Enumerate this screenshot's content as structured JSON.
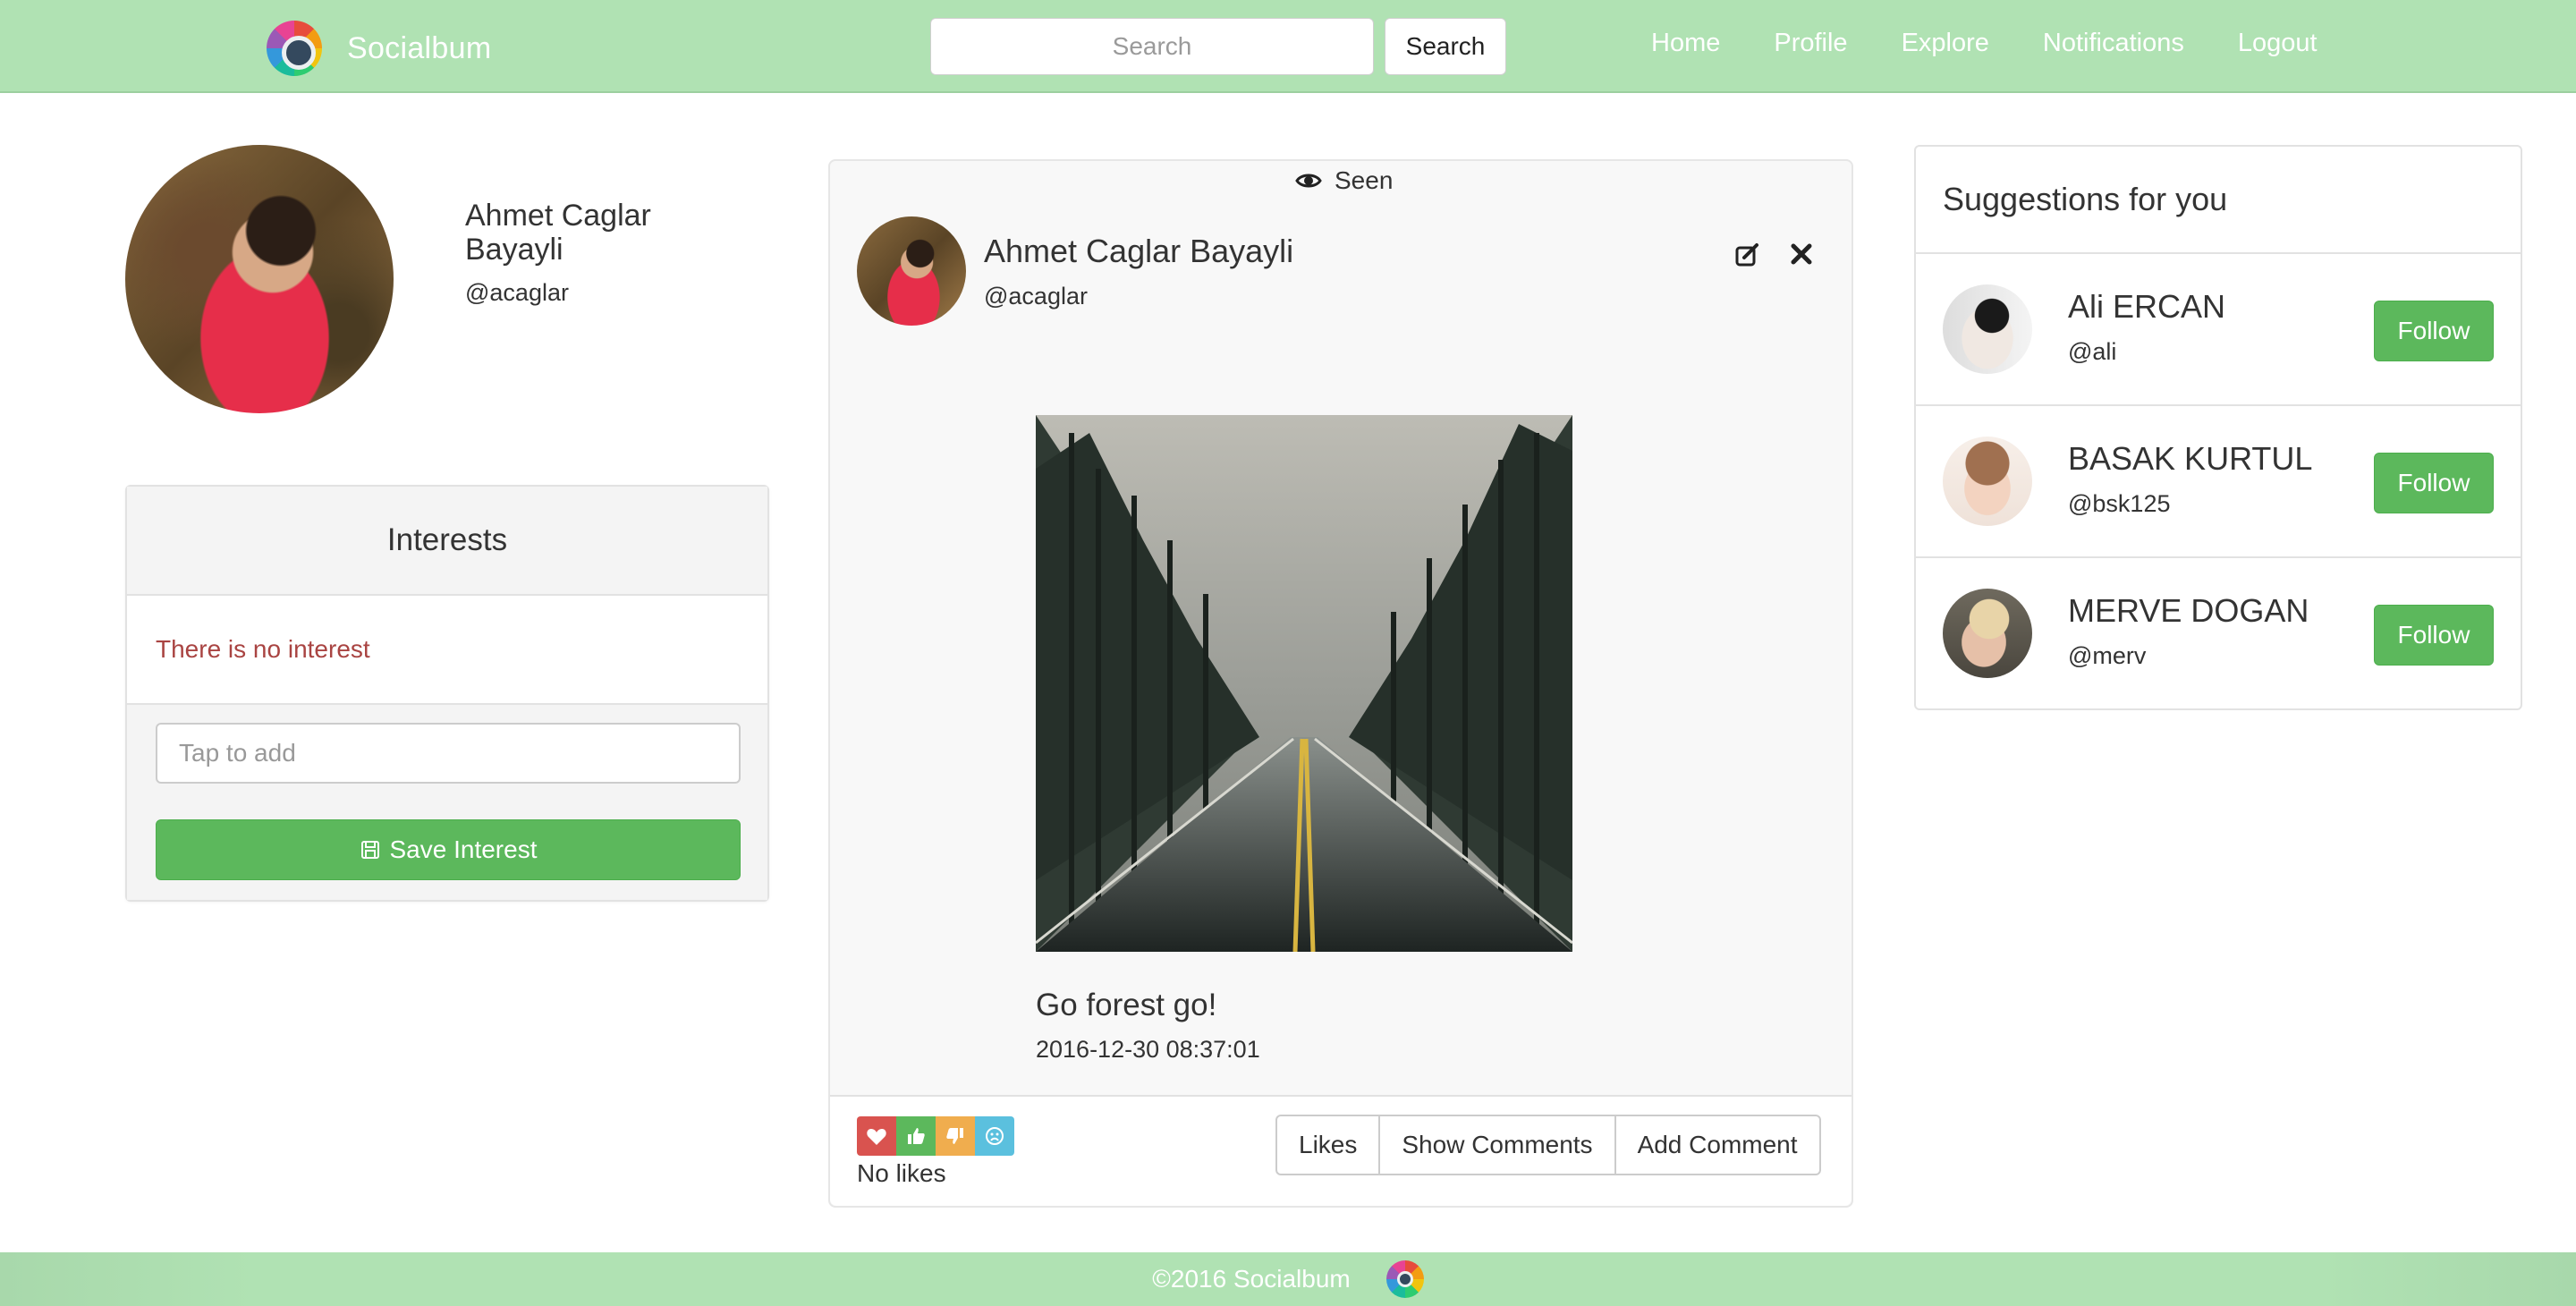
{
  "navbar": {
    "brand": "Socialbum",
    "search_placeholder": "Search",
    "search_button": "Search",
    "links": [
      "Home",
      "Profile",
      "Explore",
      "Notifications",
      "Logout"
    ]
  },
  "profile": {
    "name": "Ahmet Caglar Bayayli",
    "handle": "@acaglar"
  },
  "interests": {
    "title": "Interests",
    "empty_message": "There is no interest",
    "input_placeholder": "Tap to add",
    "save_button": "Save Interest"
  },
  "post": {
    "seen_label": "Seen",
    "author_name": "Ahmet Caglar Bayayli",
    "author_handle": "@acaglar",
    "title": "Go forest go!",
    "date": "2016-12-30 08:37:01",
    "likes_text": "No likes",
    "actions": [
      "Likes",
      "Show Comments",
      "Add Comment"
    ]
  },
  "suggestions": {
    "title": "Suggestions for you",
    "people": [
      {
        "name": "Ali ERCAN",
        "handle": "@ali",
        "follow": "Follow"
      },
      {
        "name": "BASAK KURTUL",
        "handle": "@bsk125",
        "follow": "Follow"
      },
      {
        "name": "MERVE DOGAN",
        "handle": "@merv",
        "follow": "Follow"
      }
    ]
  },
  "footer": {
    "copyright": "©2016 Socialbum"
  },
  "colors": {
    "navbar": "#b0e2b3",
    "success": "#5cb85c",
    "danger_text": "#a94442",
    "react_love": "#d9534f",
    "react_like": "#5cb85c",
    "react_dislike": "#f0ad4e",
    "react_sad": "#5bc0de"
  }
}
